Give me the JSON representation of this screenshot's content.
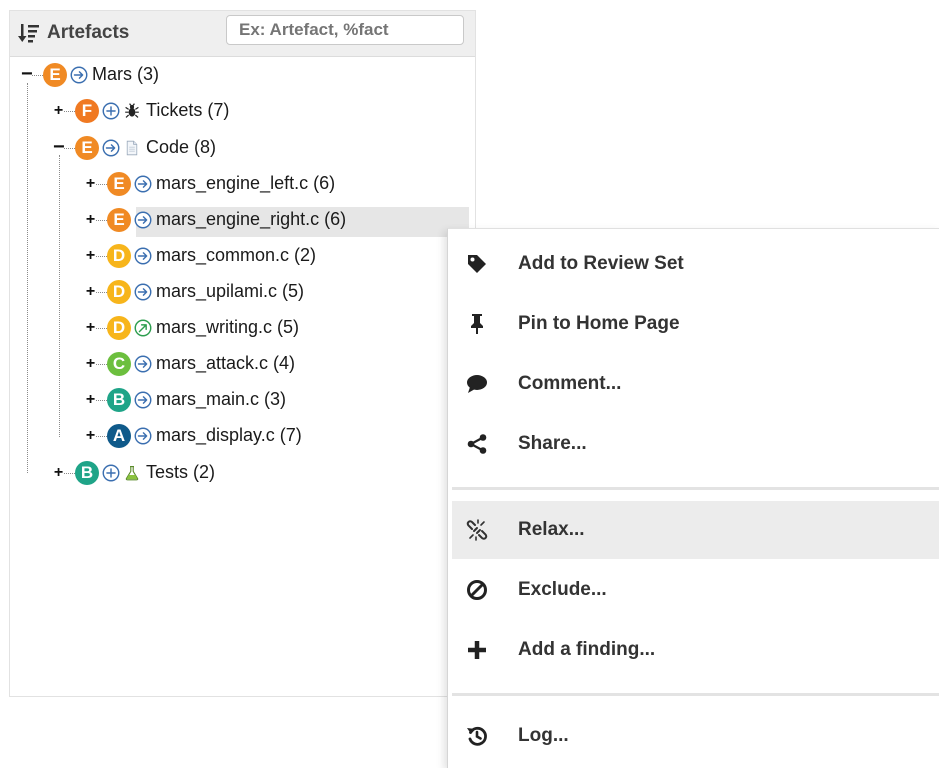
{
  "panel": {
    "title": "Artefacts",
    "filter_placeholder": "Ex: Artefact, %fact"
  },
  "colors": {
    "rating_E": "#f08a24",
    "rating_F": "#f07922",
    "rating_D": "#f7b51b",
    "rating_C": "#6cbf3e",
    "rating_B": "#1fa488",
    "rating_A": "#0f5a8a",
    "trend_stable": "#3b6fb0",
    "trend_up": "#2e9e4f",
    "highlight": "#e6e6e6"
  },
  "tree": {
    "root": {
      "rating": "E",
      "trend": "arrow-right-circle-icon",
      "label": "Mars (3)"
    },
    "tickets": {
      "rating": "F",
      "trend": "plus-circle-icon",
      "type_icon": "bug-icon",
      "label": "Tickets (7)"
    },
    "code": {
      "rating": "E",
      "trend": "arrow-right-circle-icon",
      "type_icon": "file-icon",
      "label": "Code (8)"
    },
    "files": [
      {
        "rating": "E",
        "trend": "arrow-right-circle-icon",
        "label": "mars_engine_left.c (6)"
      },
      {
        "rating": "E",
        "trend": "arrow-right-circle-icon",
        "label": "mars_engine_right.c (6)"
      },
      {
        "rating": "D",
        "trend": "arrow-right-circle-icon",
        "label": "mars_common.c (2)"
      },
      {
        "rating": "D",
        "trend": "arrow-right-circle-icon",
        "label": "mars_upilami.c (5)"
      },
      {
        "rating": "D",
        "trend": "arrow-up-right-circle-icon",
        "label": "mars_writing.c (5)"
      },
      {
        "rating": "C",
        "trend": "arrow-right-circle-icon",
        "label": "mars_attack.c (4)"
      },
      {
        "rating": "B",
        "trend": "arrow-right-circle-icon",
        "label": "mars_main.c (3)"
      },
      {
        "rating": "A",
        "trend": "arrow-right-circle-icon",
        "label": "mars_display.c (7)"
      }
    ],
    "tests": {
      "rating": "B",
      "trend": "plus-circle-icon",
      "type_icon": "flask-icon",
      "label": "Tests (2)"
    }
  },
  "context_menu": {
    "items": [
      {
        "icon": "tag-icon",
        "label": "Add to Review Set"
      },
      {
        "icon": "pin-icon",
        "label": "Pin to Home Page"
      },
      {
        "icon": "comment-icon",
        "label": "Comment..."
      },
      {
        "icon": "share-icon",
        "label": "Share..."
      },
      {
        "icon": "broken-link-icon",
        "label": "Relax..."
      },
      {
        "icon": "ban-icon",
        "label": "Exclude..."
      },
      {
        "icon": "plus-icon",
        "label": "Add a finding..."
      },
      {
        "icon": "history-icon",
        "label": "Log..."
      }
    ]
  }
}
